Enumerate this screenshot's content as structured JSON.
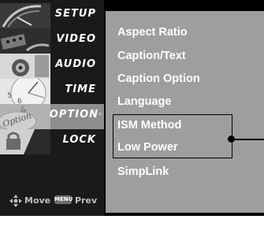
{
  "sidebar": {
    "items": [
      {
        "label": "SETUP"
      },
      {
        "label": "VIDEO"
      },
      {
        "label": "AUDIO"
      },
      {
        "label": "TIME"
      },
      {
        "label": "OPTION",
        "active": true,
        "thumb_text": "Option"
      },
      {
        "label": "LOCK"
      }
    ],
    "active_arrow": "›",
    "footer": {
      "move_label": "Move",
      "menu_badge": "MENU",
      "prev_label": "Prev"
    }
  },
  "options_panel": {
    "items": [
      {
        "label": "Aspect Ratio"
      },
      {
        "label": "Caption/Text"
      },
      {
        "label": "Caption Option"
      },
      {
        "label": "Language"
      },
      {
        "label": "ISM Method"
      },
      {
        "label": "Low Power"
      },
      {
        "label": "SimpLink"
      }
    ]
  },
  "colors": {
    "screen_bg": "#000000",
    "panel_bg": "#9e9e9e",
    "active_item_bg": "#8e8e8e",
    "text": "#ffffff"
  }
}
